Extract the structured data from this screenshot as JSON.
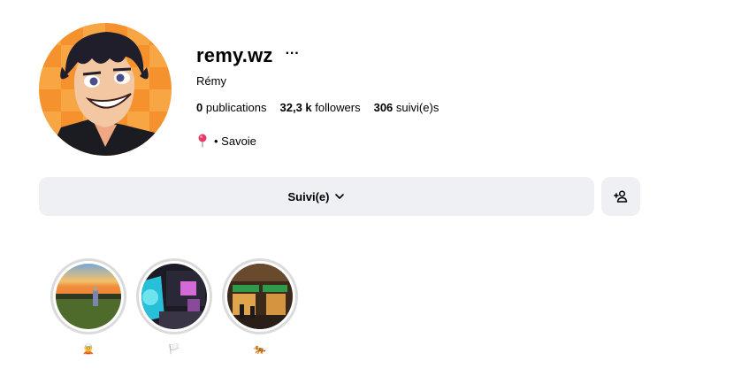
{
  "profile": {
    "username": "remy.wz",
    "more_label": "···",
    "full_name": "Rémy",
    "avatar_icon": "cartoon-avatar",
    "stats": [
      {
        "value": "0",
        "label": "publications"
      },
      {
        "value": "32,3 k",
        "label": "followers"
      },
      {
        "value": "306",
        "label": "suivi(e)s"
      }
    ],
    "location": {
      "icon": "pin-icon",
      "text": "• Savoie"
    }
  },
  "actions": {
    "follow_label": "Suivi(e)",
    "suggest_icon": "add-person-icon"
  },
  "highlights": [
    {
      "label": "🧝",
      "scene": "sunset-field"
    },
    {
      "label": "🏳️",
      "scene": "neon-screen"
    },
    {
      "label": "🐅",
      "scene": "night-street"
    }
  ],
  "colors": {
    "button_bg": "#eff0f4",
    "ring": "#dbdbdb",
    "avatar_bg": "#f5922e"
  }
}
